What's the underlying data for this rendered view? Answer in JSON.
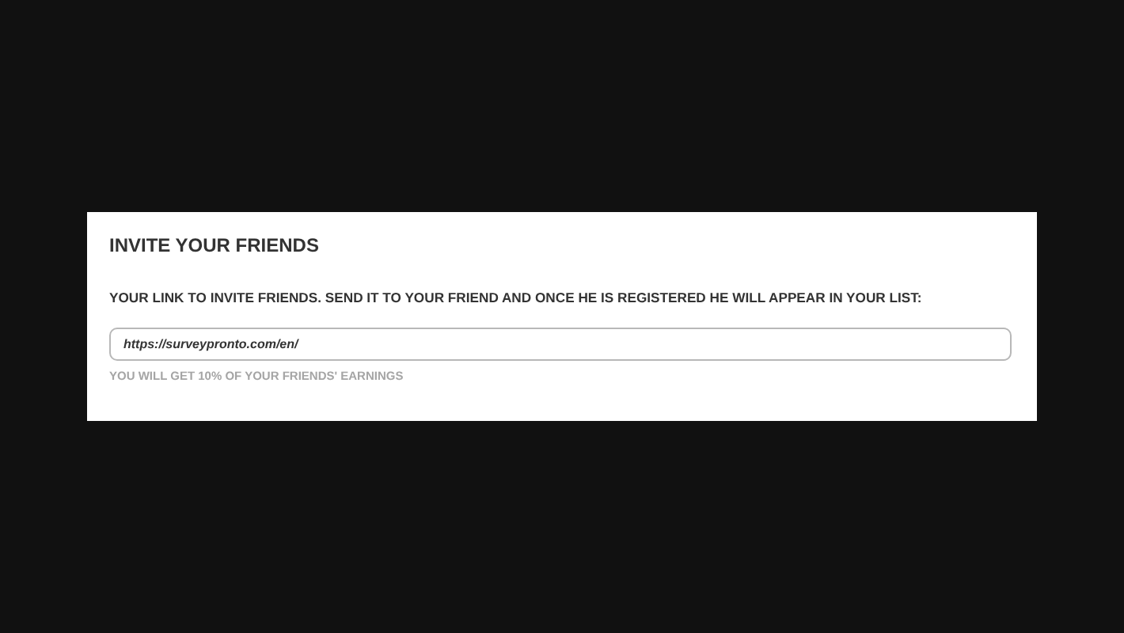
{
  "card": {
    "title": "INVITE YOUR FRIENDS",
    "link_label": "YOUR LINK TO INVITE FRIENDS. SEND IT TO YOUR FRIEND AND ONCE HE IS REGISTERED HE WILL APPEAR IN YOUR LIST:",
    "link_field": {
      "value": "https://surveypronto.com/en/"
    },
    "hint": "YOU WILL GET 10% OF YOUR FRIENDS' EARNINGS"
  }
}
